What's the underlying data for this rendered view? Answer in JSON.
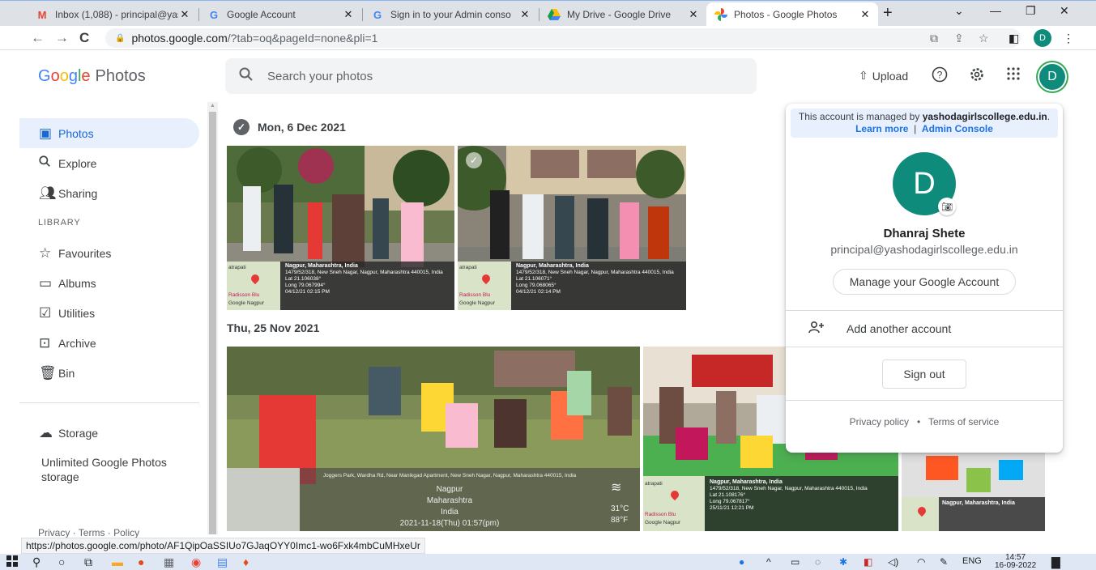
{
  "browser": {
    "tabs": [
      {
        "title": "Inbox (1,088) - principal@yas",
        "icon": "gmail-icon"
      },
      {
        "title": "Google Account",
        "icon": "google-g-icon"
      },
      {
        "title": "Sign in to your Admin conso",
        "icon": "google-g-icon"
      },
      {
        "title": "My Drive - Google Drive",
        "icon": "drive-icon"
      },
      {
        "title": "Photos - Google Photos",
        "icon": "photos-pinwheel-icon",
        "active": true
      }
    ],
    "url_host": "photos.google.com",
    "url_path": "/?tab=oq&pageId=none&pli=1",
    "profile_initial": "D"
  },
  "app": {
    "logo_letters": [
      "G",
      "o",
      "o",
      "g",
      "l",
      "e"
    ],
    "product": "Photos",
    "search_placeholder": "Search your photos",
    "upload_label": "Upload",
    "avatar_initial": "D"
  },
  "sidebar": {
    "items": [
      {
        "label": "Photos",
        "icon": "photo-icon",
        "active": true
      },
      {
        "label": "Explore",
        "icon": "search-icon"
      },
      {
        "label": "Sharing",
        "icon": "people-icon"
      }
    ],
    "library_label": "LIBRARY",
    "library_items": [
      {
        "label": "Favourites",
        "icon": "star-icon"
      },
      {
        "label": "Albums",
        "icon": "album-icon"
      },
      {
        "label": "Utilities",
        "icon": "checkbox-icon"
      },
      {
        "label": "Archive",
        "icon": "archive-icon"
      },
      {
        "label": "Bin",
        "icon": "trash-icon"
      }
    ],
    "storage_label": "Storage",
    "storage_text": "Unlimited Google Photos storage",
    "footer": "Privacy · Terms · Policy"
  },
  "content": {
    "groups": [
      {
        "date": "Mon, 6 Dec 2021",
        "photos": [
          {
            "loc": "Nagpur, Maharashtra, India",
            "addr": "1479/52/318, New Sneh Nagar, Nagpur, Maharashtra 440015, India",
            "lat": "Lat 21.106038°",
            "long": "Long 79.067994°",
            "time": "04/12/21 02:15 PM",
            "map1": "atrapati",
            "map2": "Radisson Blu",
            "map3": "Google Nagpur"
          },
          {
            "loc": "Nagpur, Maharashtra, India",
            "addr": "1479/52/318, New Sneh Nagar, Nagpur, Maharashtra 440015, India",
            "lat": "Lat 21.106071°",
            "long": "Long 79.068065°",
            "time": "04/12/21 02:14 PM",
            "map1": "atrapati",
            "map2": "Radisson Blu",
            "map3": "Google Nagpur"
          }
        ]
      },
      {
        "date": "Thu, 25 Nov 2021",
        "photos": [
          {
            "addr": "Joggers Park, Wardha Rd, Near Manikgad Apartment, New Sneh Nagar, Nagpur, Maharashtra 440015, India",
            "city": "Nagpur",
            "state": "Maharashtra",
            "country": "India",
            "time": "2021-11-18(Thu)  01:57(pm)",
            "temp_c": "31°C",
            "temp_f": "88°F"
          },
          {
            "loc": "Nagpur, Maharashtra, India",
            "addr": "1479/52/318, New Sneh Nagar, Nagpur, Maharashtra 440015, India",
            "lat": "Lat 21.108176°",
            "long": "Long 79.067817°",
            "time": "25/11/21 12:21 PM",
            "map1": "atrapati",
            "map2": "Radisson Blu",
            "map3": "Google Nagpur"
          },
          {
            "loc": "Nagpur, Maharashtra, India"
          }
        ]
      }
    ]
  },
  "account_popup": {
    "managed_prefix": "This account is managed by",
    "managed_domain": "yashodagirlscollege.edu.in",
    "learn_more": "Learn more",
    "separator": "|",
    "admin_console": "Admin Console",
    "initial": "D",
    "name": "Dhanraj Shete",
    "email": "principal@yashodagirlscollege.edu.in",
    "manage_label": "Manage your Google Account",
    "add_account_label": "Add another account",
    "sign_out_label": "Sign out",
    "privacy_label": "Privacy policy",
    "dot": "•",
    "terms_label": "Terms of service"
  },
  "status_url": "https://photos.google.com/photo/AF1QipOaSSIUo7GJaqOYY0Imc1-wo6Fxk4mbCuMHxeUr",
  "taskbar": {
    "lang": "ENG",
    "time": "14:57",
    "date": "16-09-2022"
  }
}
